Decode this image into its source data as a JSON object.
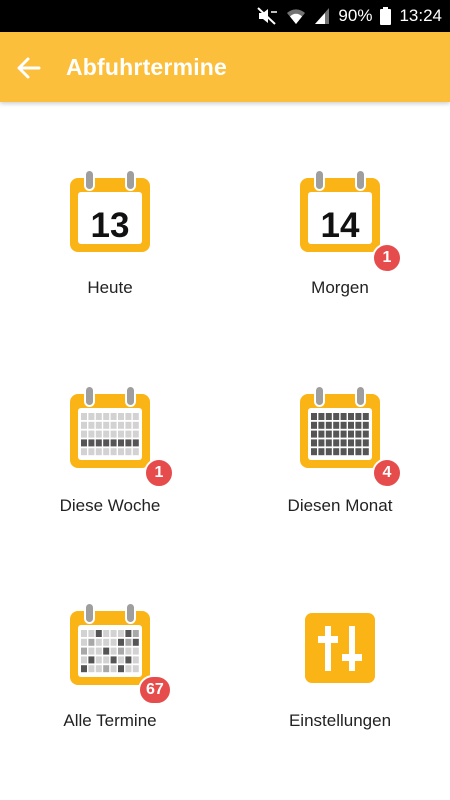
{
  "status_bar": {
    "battery": "90%",
    "time": "13:24"
  },
  "app_bar": {
    "title": "Abfuhrtermine",
    "back_icon": "arrow-back-icon"
  },
  "colors": {
    "accent": "#fbbf3b",
    "badge": "#e74c4c"
  },
  "tiles": [
    {
      "label": "Heute",
      "day": "13",
      "icon": "calendar-day-icon"
    },
    {
      "label": "Morgen",
      "day": "14",
      "badge": "1",
      "icon": "calendar-day-icon"
    },
    {
      "label": "Diese Woche",
      "badge": "1",
      "icon": "calendar-week-icon"
    },
    {
      "label": "Diesen Monat",
      "badge": "4",
      "icon": "calendar-month-icon"
    },
    {
      "label": "Alle Termine",
      "badge": "67",
      "icon": "calendar-all-icon"
    },
    {
      "label": "Einstellungen",
      "icon": "settings-sliders-icon"
    }
  ]
}
